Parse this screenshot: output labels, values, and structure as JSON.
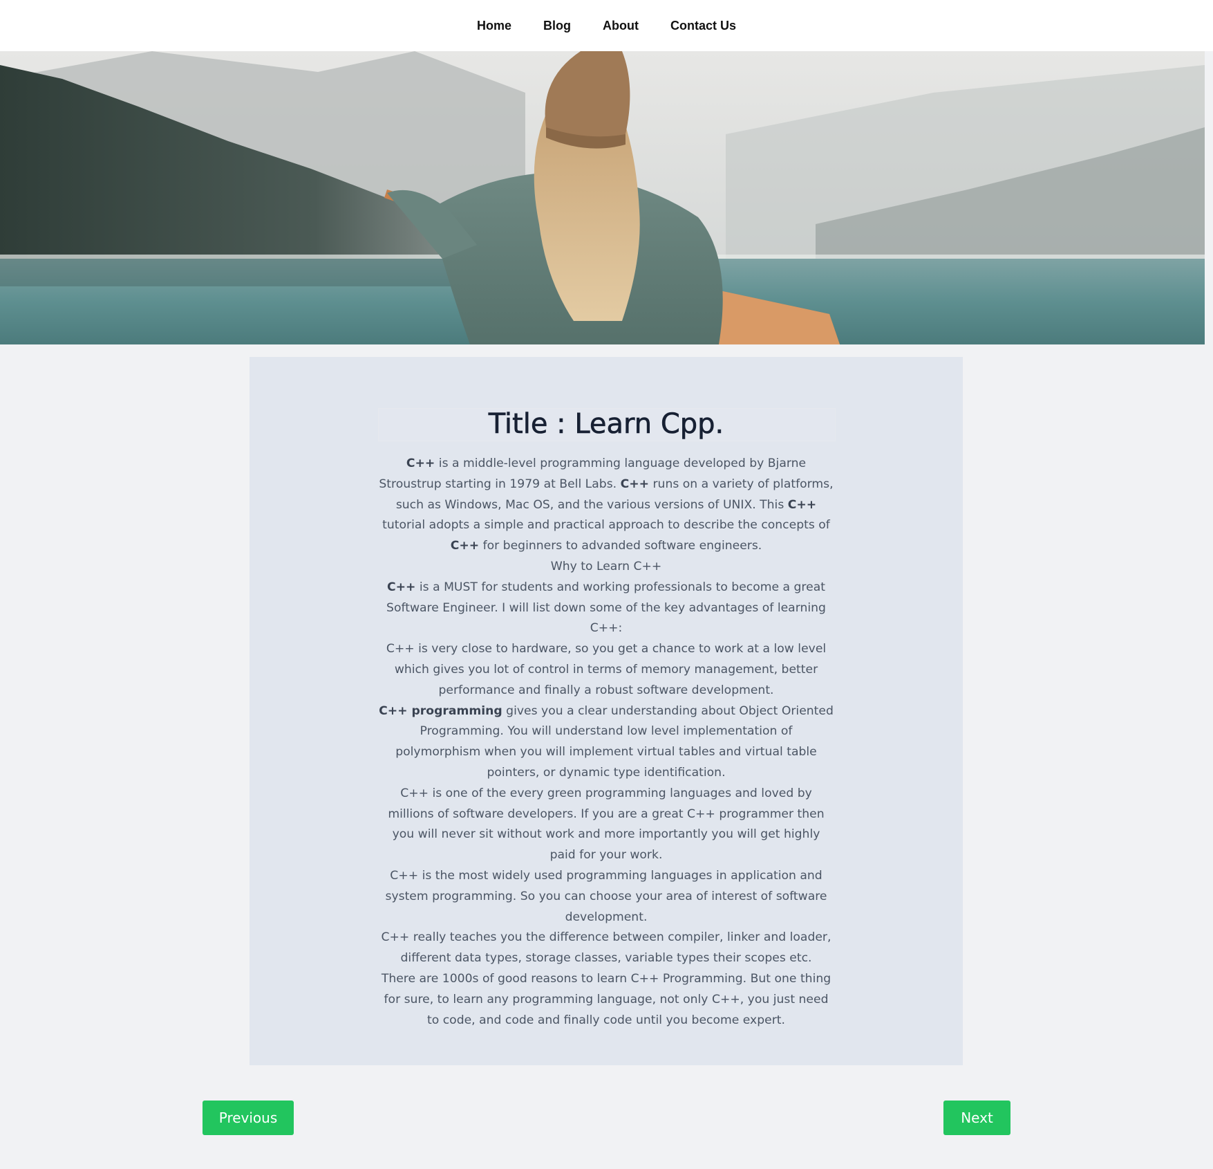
{
  "nav": {
    "items": [
      {
        "label": "Home"
      },
      {
        "label": "Blog"
      },
      {
        "label": "About"
      },
      {
        "label": "Contact Us"
      }
    ]
  },
  "hero": {
    "alt": "Woman with knit beanie paddling a canoe on a misty mountain lake"
  },
  "article": {
    "title": "Title : Learn Cpp.",
    "p1": {
      "b1": "C++",
      "t1": " is a middle-level programming language developed by Bjarne Stroustrup starting in 1979 at Bell Labs. ",
      "b2": "C++",
      "t2": " runs on a variety of platforms, such as Windows, Mac OS, and the various versions of UNIX. This ",
      "b3": "C++",
      "t3": " tutorial adopts a simple and practical approach to describe the concepts of ",
      "b4": "C++",
      "t4": " for beginners to advanded software engineers."
    },
    "p2": "Why to Learn C++",
    "p3": {
      "b1": "C++",
      "t1": " is a MUST for students and working professionals to become a great Software Engineer. I will list down some of the key advantages of learning C++:"
    },
    "p4": "C++ is very close to hardware, so you get a chance to work at a low level which gives you lot of control in terms of memory management, better performance and finally a robust software development.",
    "p5": {
      "b1": "C++ programming",
      "t1": " gives you a clear understanding about Object Oriented Programming. You will understand low level implementation of polymorphism when you will implement virtual tables and virtual table pointers, or dynamic type identification."
    },
    "p6": "C++ is one of the every green programming languages and loved by millions of software developers. If you are a great C++ programmer then you will never sit without work and more importantly you will get highly paid for your work.",
    "p7": "C++ is the most widely used programming languages in application and system programming. So you can choose your area of interest of software development.",
    "p8": "C++ really teaches you the difference between compiler, linker and loader, different data types, storage classes, variable types their scopes etc.",
    "p9": "There are 1000s of good reasons to learn C++ Programming. But one thing for sure, to learn any programming language, not only C++, you just need to code, and code and finally code until you become expert."
  },
  "pagination": {
    "previous_label": "Previous",
    "next_label": "Next"
  },
  "colors": {
    "button": "#22c55e",
    "card_bg": "#e1e6ee",
    "page_bg": "#f1f2f4"
  }
}
